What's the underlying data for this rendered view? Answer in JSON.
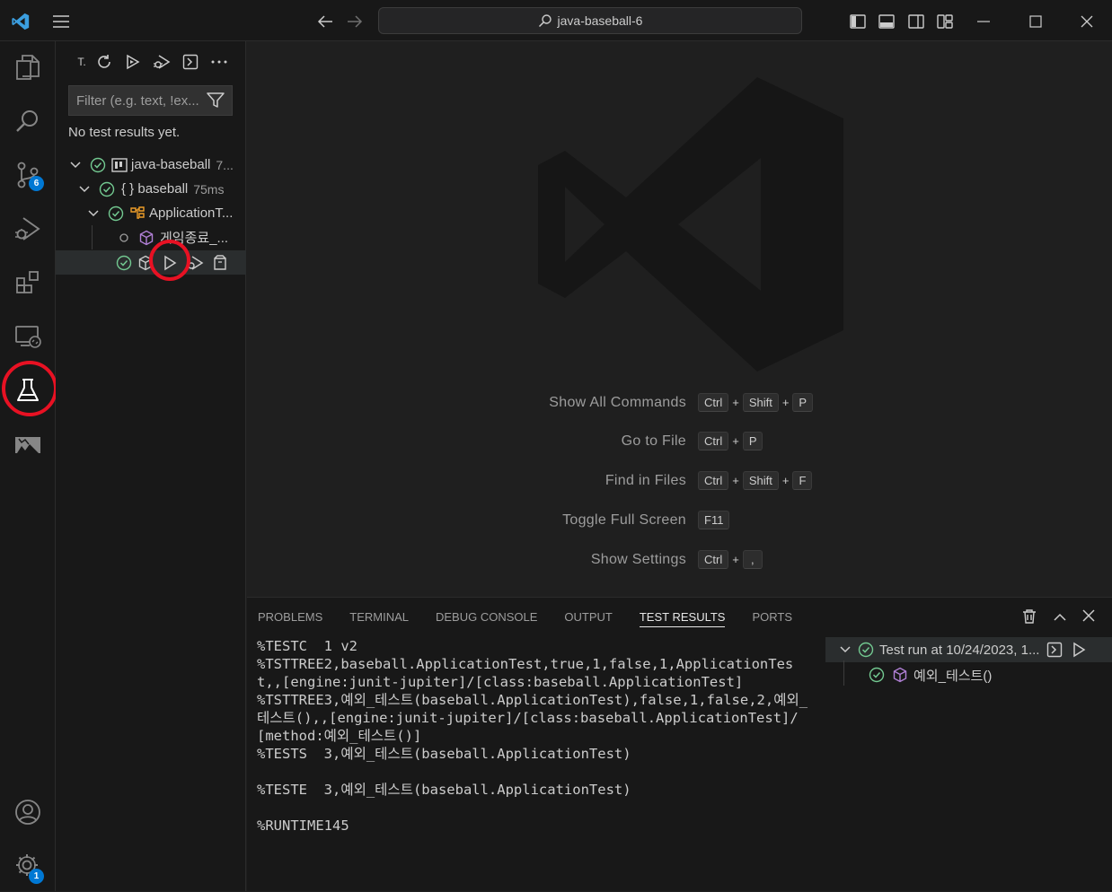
{
  "titlebar": {
    "search_text": "java-baseball-6"
  },
  "activity": {
    "source_control_badge": "6",
    "accounts_badge": "1"
  },
  "sidebar": {
    "toolbar_title": "T.",
    "filter_placeholder": "Filter (e.g. text, !ex...",
    "no_results": "No test results yet.",
    "tree": [
      {
        "label": "java-baseball",
        "meta": "7..."
      },
      {
        "label": "{ } baseball",
        "meta": "75ms"
      },
      {
        "label": "ApplicationT...",
        "meta": ""
      },
      {
        "label": "게임종료_...",
        "meta": ""
      },
      {
        "label": "",
        "meta": ""
      }
    ]
  },
  "editor": {
    "shortcuts": [
      {
        "label": "Show All Commands",
        "keys": [
          "Ctrl",
          "Shift",
          "P"
        ]
      },
      {
        "label": "Go to File",
        "keys": [
          "Ctrl",
          "P"
        ]
      },
      {
        "label": "Find in Files",
        "keys": [
          "Ctrl",
          "Shift",
          "F"
        ]
      },
      {
        "label": "Toggle Full Screen",
        "keys": [
          "F11"
        ]
      },
      {
        "label": "Show Settings",
        "keys": [
          "Ctrl",
          ","
        ]
      }
    ]
  },
  "panel": {
    "tabs": [
      "PROBLEMS",
      "TERMINAL",
      "DEBUG CONSOLE",
      "OUTPUT",
      "TEST RESULTS",
      "PORTS"
    ],
    "active_tab": "TEST RESULTS",
    "output_lines": [
      "%TESTC  1 v2",
      "%TSTTREE2,baseball.ApplicationTest,true,1,false,1,ApplicationTest,,[engine:junit-jupiter]/[class:baseball.ApplicationTest]",
      "%TSTTREE3,예외_테스트(baseball.ApplicationTest),false,1,false,2,예외_테스트(),,[engine:junit-jupiter]/[class:baseball.ApplicationTest]/[method:예외_테스트()]",
      "%TESTS  3,예외_테스트(baseball.ApplicationTest)",
      "",
      "%TESTE  3,예외_테스트(baseball.ApplicationTest)",
      "",
      "%RUNTIME145"
    ],
    "results": {
      "run_label": "Test run at 10/24/2023, 1...",
      "test_label": "예외_테스트()"
    }
  },
  "colors": {
    "accent": "#0078d4",
    "pass": "#73c991",
    "highlight": "#e81123"
  }
}
